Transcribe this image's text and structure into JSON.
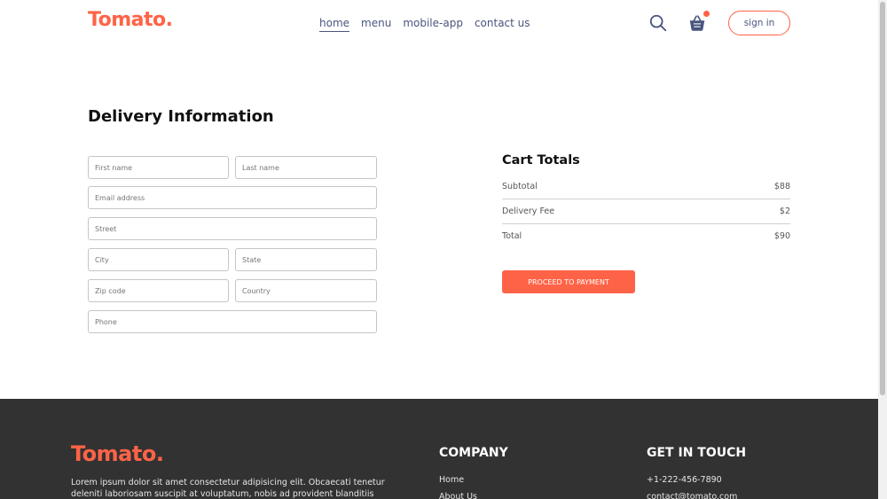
{
  "brand": {
    "logo_text": "Tomato.",
    "accent_color": "#ff6347",
    "nav_text_color": "#49557e"
  },
  "navbar": {
    "menu": [
      {
        "label": "home",
        "active": true
      },
      {
        "label": "menu"
      },
      {
        "label": "mobile-app"
      },
      {
        "label": "contact us"
      }
    ],
    "icons": [
      "search-icon",
      "basket-icon"
    ],
    "sign_in_label": "sign in"
  },
  "delivery": {
    "title": "Delivery Information",
    "placeholders": {
      "first_name": "First name",
      "last_name": "Last name",
      "email": "Email address",
      "street": "Street",
      "city": "City",
      "state": "State",
      "zip": "Zip code",
      "country": "Country",
      "phone": "Phone"
    }
  },
  "cart_totals": {
    "title": "Cart Totals",
    "rows": [
      {
        "label": "Subtotal",
        "value": "$88"
      },
      {
        "label": "Delivery Fee",
        "value": "$2"
      },
      {
        "label": "Total",
        "value": "$90"
      }
    ],
    "button_label": "PROCEED TO PAYMENT"
  },
  "footer": {
    "logo_text": "Tomato.",
    "description": "Lorem ipsum dolor sit amet consectetur adipisicing elit. Obcaecati tenetur deleniti laboriosam suscipit at voluptatum, nobis ad provident blanditiis quam",
    "company": {
      "heading": "COMPANY",
      "links": [
        "Home",
        "About Us"
      ]
    },
    "contact": {
      "heading": "GET IN TOUCH",
      "phone": "+1-222-456-7890",
      "email": "contact@tomato.com"
    }
  }
}
